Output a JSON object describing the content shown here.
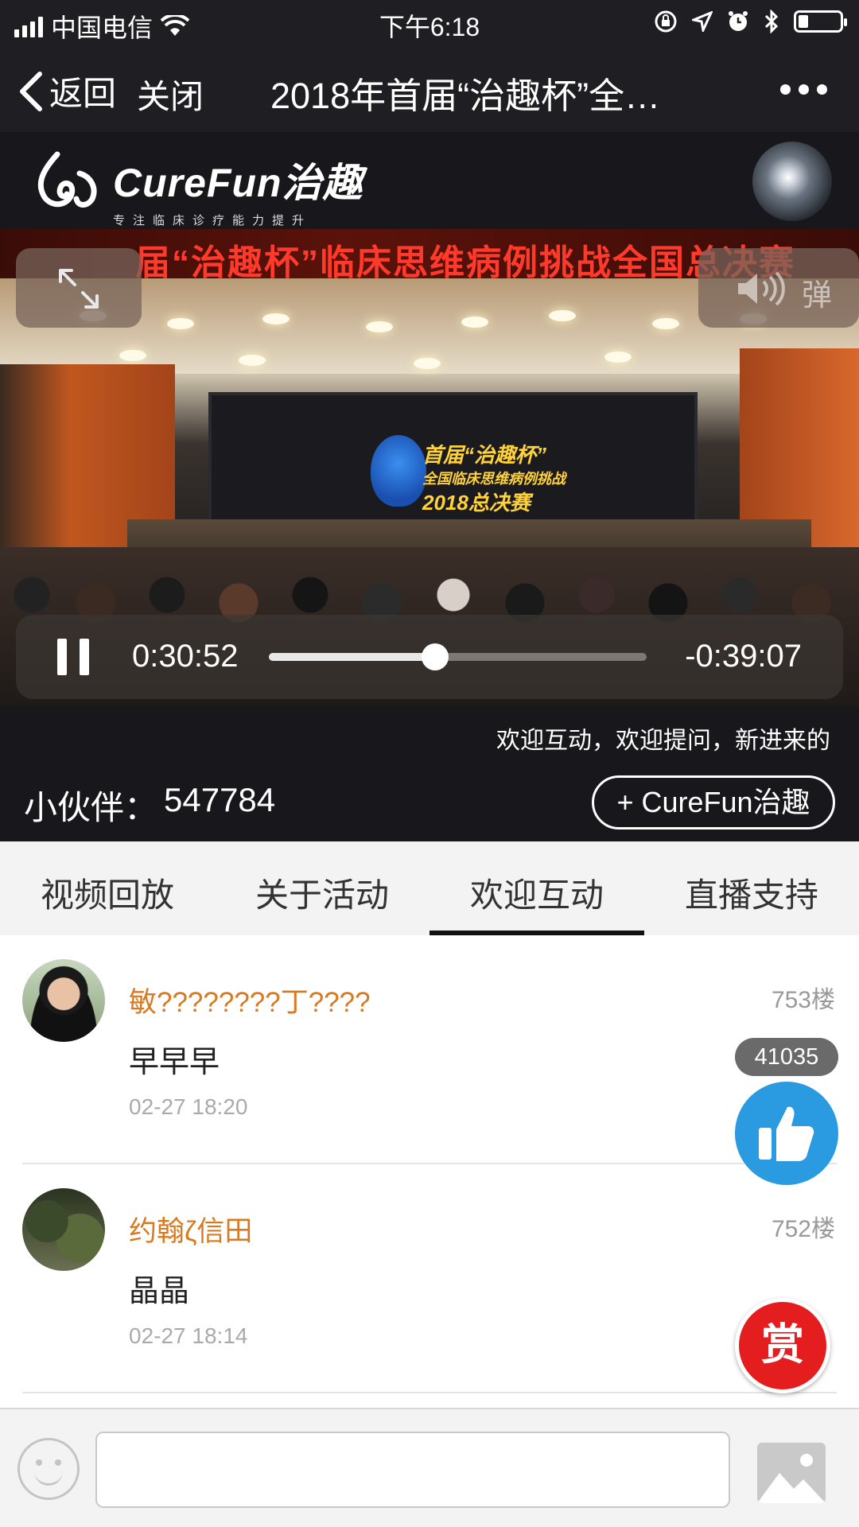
{
  "status_bar": {
    "carrier": "中国电信",
    "time": "下午6:18",
    "battery_level": 0.25
  },
  "nav": {
    "back_label": "返回",
    "close_label": "关闭",
    "title": "2018年首届“治趣杯”全…"
  },
  "brand": {
    "name": "CureFun治趣",
    "tagline": "专注临床诊疗能力提升"
  },
  "video": {
    "banner_text": "届“治趣杯”临床思维病例挑战全国总决赛",
    "screen_text_line1": "首届“治趣杯”",
    "screen_text_line2": "全国临床思维病例挑战",
    "screen_text_line3": "2018总决赛",
    "danmu_label": "弹",
    "elapsed": "0:30:52",
    "remaining": "-0:39:07",
    "progress": 0.44
  },
  "ticker": {
    "text": "欢迎互动，欢迎提问，新进来的"
  },
  "follow_bar": {
    "label": "小伙伴：",
    "count": "547784",
    "follow_label": "+ CureFun治趣"
  },
  "tabs": [
    {
      "label": "视频回放"
    },
    {
      "label": "关于活动"
    },
    {
      "label": "欢迎互动",
      "active": true
    },
    {
      "label": "直播支持"
    }
  ],
  "comments": [
    {
      "name": "敏????????丁????",
      "floor": "753楼",
      "text": "早早早",
      "time": "02-27 18:20"
    },
    {
      "name": "约翰ζ信田",
      "floor": "752楼",
      "text": "晶晶",
      "time": "02-27 18:14"
    }
  ],
  "like": {
    "count": "41035"
  },
  "reward": {
    "label": "赏"
  },
  "input": {
    "value": "",
    "placeholder": ""
  },
  "colors": {
    "accent_blue": "#2a9be0",
    "reward_red": "#e41e1e",
    "username_orange": "#d77a22",
    "dark_bar": "#1f1e22"
  },
  "icons": [
    "signal-icon",
    "wifi-icon",
    "lock-rotation-icon",
    "location-icon",
    "alarm-icon",
    "bluetooth-icon",
    "battery-icon",
    "back-chevron-icon",
    "more-icon",
    "expand-icon",
    "volume-icon",
    "pause-icon",
    "thumbs-up-icon",
    "emoji-icon",
    "image-icon"
  ]
}
